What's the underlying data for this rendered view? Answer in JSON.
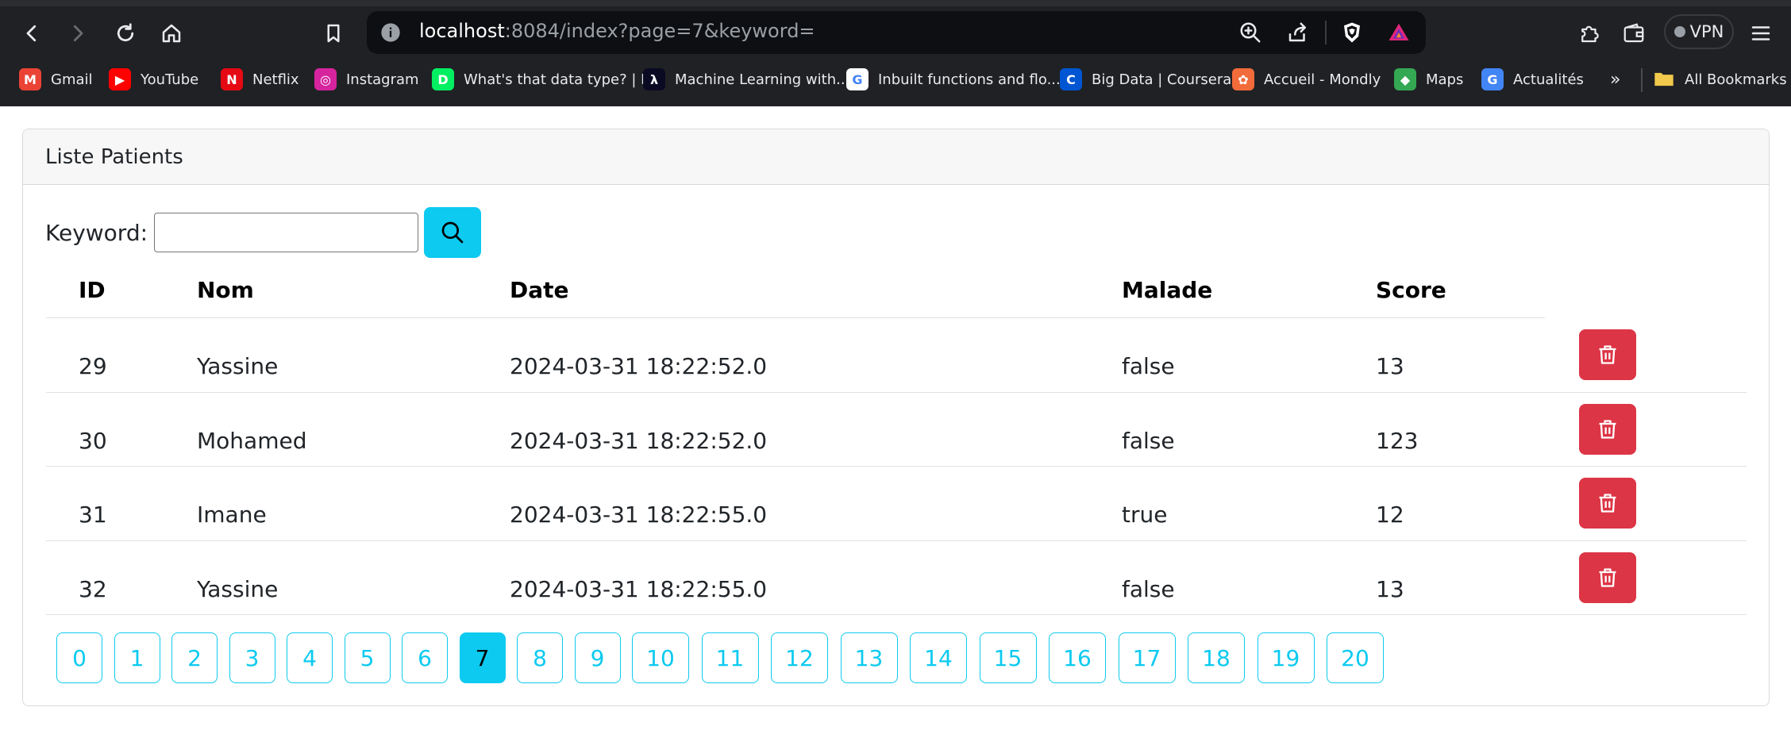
{
  "browser": {
    "url_host": "localhost",
    "url_rest": ":8084/index?page=7&keyword=",
    "vpn_label": "VPN",
    "bookmarks": [
      {
        "label": "Gmail",
        "icon": "gmail-icon",
        "color": "#ea4335",
        "glyph": "M"
      },
      {
        "label": "YouTube",
        "icon": "youtube-icon",
        "color": "#ff0000",
        "glyph": "▶"
      },
      {
        "label": "Netflix",
        "icon": "netflix-icon",
        "color": "#e50914",
        "glyph": "N"
      },
      {
        "label": "Instagram",
        "icon": "instagram-icon",
        "color": "#d6249f",
        "glyph": "◎"
      },
      {
        "label": "What's that data type? | R",
        "icon": "datacamp-icon",
        "color": "#03ef62",
        "glyph": "D"
      },
      {
        "label": "Machine Learning with...",
        "icon": "freecodecamp-icon",
        "color": "#0a0a23",
        "glyph": "λ"
      },
      {
        "label": "Inbuilt functions and flo...",
        "icon": "google-icon",
        "color": "#ffffff",
        "glyph": "G"
      },
      {
        "label": "Big Data | Coursera",
        "icon": "coursera-icon",
        "color": "#0056d2",
        "glyph": "C"
      },
      {
        "label": "Accueil - Mondly",
        "icon": "mondly-icon",
        "color": "#f26b3a",
        "glyph": "✿"
      },
      {
        "label": "Maps",
        "icon": "maps-icon",
        "color": "#34a853",
        "glyph": "◆"
      },
      {
        "label": "Actualités",
        "icon": "news-icon",
        "color": "#4285f4",
        "glyph": "G"
      }
    ],
    "more_label": "»",
    "all_bookmarks_label": "All Bookmarks"
  },
  "card": {
    "title": "Liste Patients"
  },
  "search": {
    "label": "Keyword:",
    "value": ""
  },
  "table": {
    "headers": [
      "ID",
      "Nom",
      "Date",
      "Malade",
      "Score"
    ],
    "rows": [
      {
        "id": "29",
        "nom": "Yassine",
        "date": "2024-03-31 18:22:52.0",
        "malade": "false",
        "score": "13"
      },
      {
        "id": "30",
        "nom": "Mohamed",
        "date": "2024-03-31 18:22:52.0",
        "malade": "false",
        "score": "123"
      },
      {
        "id": "31",
        "nom": "Imane",
        "date": "2024-03-31 18:22:55.0",
        "malade": "true",
        "score": "12"
      },
      {
        "id": "32",
        "nom": "Yassine",
        "date": "2024-03-31 18:22:55.0",
        "malade": "false",
        "score": "13"
      }
    ]
  },
  "pagination": {
    "pages": [
      "0",
      "1",
      "2",
      "3",
      "4",
      "5",
      "6",
      "7",
      "8",
      "9",
      "10",
      "11",
      "12",
      "13",
      "14",
      "15",
      "16",
      "17",
      "18",
      "19",
      "20"
    ],
    "current": "7"
  },
  "colors": {
    "accent": "#0dcaf0",
    "danger": "#dc3545"
  }
}
